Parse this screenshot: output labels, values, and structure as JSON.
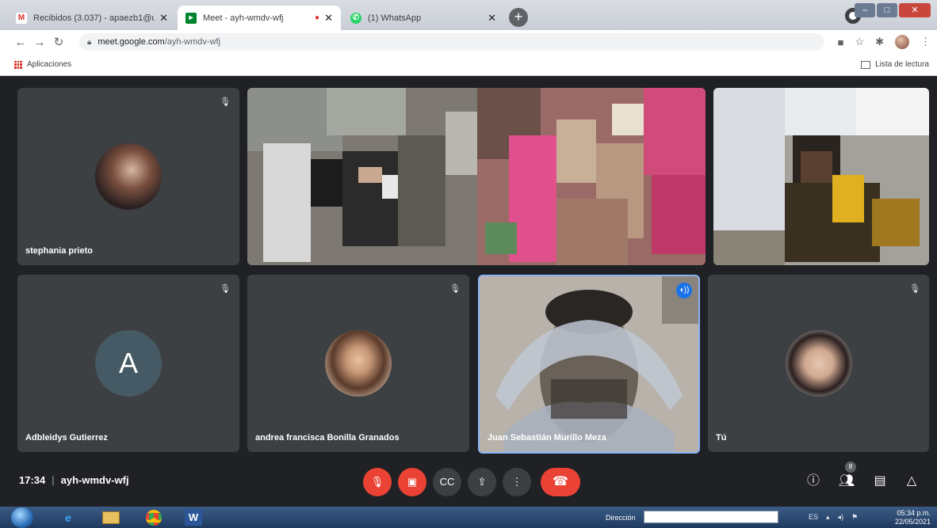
{
  "browser": {
    "tabs": [
      {
        "title": "Recibidos (3.037) - apaezb1@u...",
        "favicon": "gmail-icon",
        "active": false
      },
      {
        "title": "Meet - ayh-wmdv-wfj",
        "favicon": "meet-icon",
        "active": true
      },
      {
        "title": "(1) WhatsApp",
        "favicon": "whatsapp-icon",
        "active": false
      }
    ],
    "url_host": "meet.google.com",
    "url_path": "/ayh-wmdv-wfj",
    "bookmark_apps": "Aplicaciones",
    "reading_list": "Lista de lectura"
  },
  "meet": {
    "participants": [
      {
        "name": "stephania prieto",
        "type": "photo"
      },
      {
        "name": "",
        "type": "video"
      },
      {
        "name": "",
        "type": "video"
      },
      {
        "name": "Adbleidys Gutierrez",
        "type": "initial",
        "initial": "A"
      },
      {
        "name": "andrea francisca Bonilla Granados",
        "type": "photo"
      },
      {
        "name": "Juan Sebastián Murillo Meza",
        "type": "video",
        "speaking": true
      },
      {
        "name": "Tú",
        "type": "photo"
      }
    ],
    "time": "17:34",
    "code": "ayh-wmdv-wfj",
    "people_count": "8"
  },
  "taskbar": {
    "address_label": "Dirección",
    "lang": "ES",
    "clock_time": "05:34 p.m.",
    "clock_date": "22/05/2021"
  },
  "colors": {
    "meet_bg": "#202124",
    "tile_bg": "#3c4043",
    "red": "#ea4335",
    "blue": "#1a73e8",
    "initial_avatar": "#455a64"
  }
}
